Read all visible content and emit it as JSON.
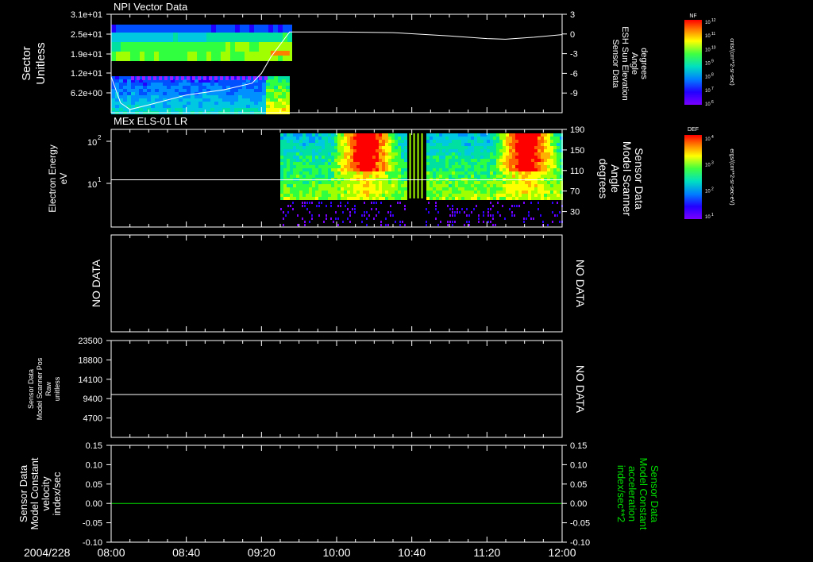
{
  "panels": {
    "npi": {
      "title": "NPI Vector Data",
      "left_label": [
        "Sector",
        "Unitless"
      ],
      "left_ticks": [
        "3.1e+01",
        "2.5e+01",
        "1.9e+01",
        "1.2e+01",
        "6.2e+00"
      ],
      "right_label": [
        "Sensor Data",
        "ESH Sun Elevation",
        "Angle",
        "degrees"
      ],
      "right_ticks": [
        "3",
        "0",
        "-3",
        "-6",
        "-9"
      ]
    },
    "els": {
      "title": "MEx ELS-01 LR",
      "left_label": [
        "Electron Energy",
        "eV"
      ],
      "left_ticks": [
        "10",
        "10"
      ],
      "left_exponents": [
        "2",
        "1"
      ],
      "right_label": [
        "Sensor Data",
        "Model Scanner",
        "Angle",
        "degrees"
      ],
      "right_ticks": [
        "190",
        "150",
        "110",
        "70",
        "30"
      ]
    },
    "nodata": {
      "left_text": "NO DATA",
      "right_text": "NO DATA"
    },
    "scanner_pos": {
      "left_label": [
        "Sensor Data",
        "Model Scanner Pos",
        "Raw",
        "unitless"
      ],
      "left_ticks": [
        "23500",
        "18800",
        "14100",
        "9400",
        "4700"
      ],
      "right_text": "NO DATA"
    },
    "velocity": {
      "left_label": [
        "Sensor Data",
        "Model Constant",
        "velocity",
        "index/sec"
      ],
      "left_ticks": [
        "0.15",
        "0.10",
        "0.05",
        "0.00",
        "-0.05",
        "-0.10"
      ],
      "right_label": [
        "Sensor Data",
        "Model Constant",
        "acceleration",
        "index/sec**2"
      ],
      "right_ticks": [
        "0.15",
        "0.10",
        "0.05",
        "0.00",
        "-0.05",
        "-0.10"
      ]
    }
  },
  "colorbars": {
    "nf": {
      "title": "NF",
      "unit": "cnts/(cm**2-sr-sec)",
      "tick_exponents": [
        "12",
        "11",
        "10",
        "9",
        "8",
        "7",
        "6"
      ]
    },
    "def": {
      "title": "DEF",
      "unit": "ergs/(cm**2-sr-sec-eV)",
      "tick_exponents": [
        "4",
        "3",
        "2",
        "1"
      ]
    }
  },
  "time_axis": {
    "date": "2004/228",
    "ticks": [
      "08:00",
      "08:40",
      "09:20",
      "10:00",
      "10:40",
      "11:20",
      "12:00"
    ]
  },
  "colors": {
    "background": "#000000",
    "foreground": "#ffffff",
    "acceleration": "#00e000"
  },
  "chart_data": [
    {
      "type": "heatmap",
      "title": "NPI Vector Data",
      "ylabel": "Sector Unitless",
      "y2label": "Sensor Data ESH Sun Elevation Angle degrees",
      "x_range": [
        "08:00",
        "12:00"
      ],
      "data_coverage": [
        "08:00",
        "09:35"
      ],
      "y2lim": [
        -12,
        3
      ],
      "series": [
        {
          "type": "line",
          "x": [
            "08:00",
            "08:05",
            "08:10",
            "08:20",
            "08:40",
            "09:00",
            "09:15",
            "09:20",
            "09:25",
            "09:35",
            "10:00",
            "10:30",
            "11:00",
            "11:20",
            "11:30",
            "11:45",
            "12:00"
          ],
          "values": [
            -6.5,
            -10.5,
            -11.5,
            -10.8,
            -9.3,
            -8.5,
            -7.5,
            -6.0,
            -3.5,
            0.3,
            0.3,
            0.2,
            -0.3,
            -0.7,
            -0.8,
            -0.5,
            -0.1
          ]
        }
      ]
    },
    {
      "type": "heatmap",
      "title": "MEx ELS-01 LR",
      "ylabel": "Electron Energy eV",
      "y2label": "Sensor Data Model Scanner Angle degrees",
      "y_scale": "log",
      "ylim": [
        1,
        200
      ],
      "y2lim": [
        0,
        190
      ],
      "x_range": [
        "08:00",
        "12:00"
      ],
      "data_coverage": [
        "09:30",
        "12:00"
      ],
      "data_gaps": [
        [
          "10:37",
          "10:47"
        ]
      ],
      "series": [
        {
          "type": "line",
          "x": [
            "08:00",
            "12:00"
          ],
          "values": [
            92,
            92
          ]
        }
      ]
    },
    {
      "type": "line",
      "ylabel": "Sensor Data Model Scanner Pos Raw unitless",
      "ylim": [
        0,
        23500
      ],
      "x_range": [
        "08:00",
        "12:00"
      ],
      "series": [
        {
          "x": [
            "08:00",
            "12:00"
          ],
          "values": [
            10400,
            10400
          ]
        }
      ]
    },
    {
      "type": "line",
      "ylabel": "Sensor Data Model Constant velocity index/sec",
      "y2label": "Sensor Data Model Constant acceleration index/sec**2",
      "ylim": [
        -0.1,
        0.15
      ],
      "x_range": [
        "08:00",
        "12:00"
      ],
      "series": [
        {
          "x": [
            "08:00",
            "12:00"
          ],
          "values": [
            0.0,
            0.0
          ]
        }
      ]
    }
  ]
}
